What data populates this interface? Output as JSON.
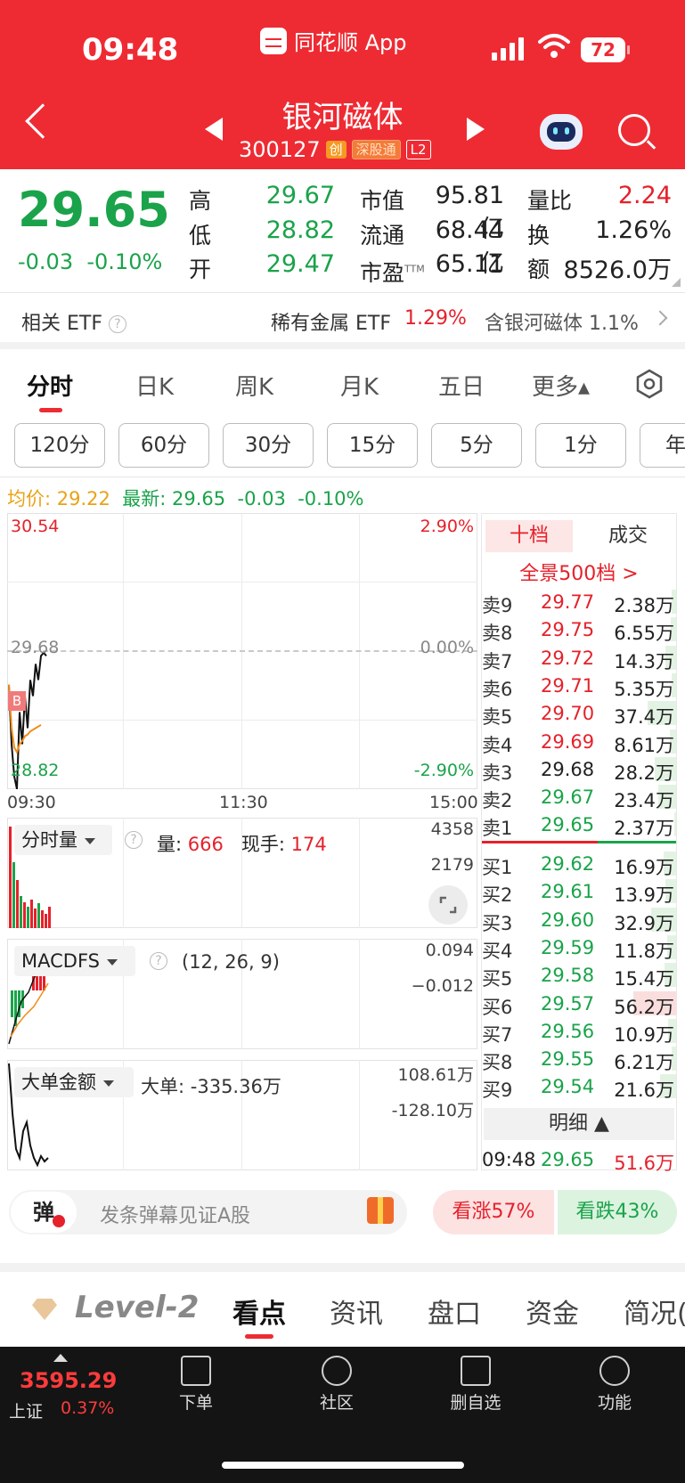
{
  "status_bar": {
    "time": "09:48",
    "app_name": "同花顺 App",
    "battery": "72"
  },
  "header": {
    "stock_name": "银河磁体",
    "stock_code": "300127",
    "tags": [
      "创",
      "深股通",
      "L2"
    ]
  },
  "quote": {
    "price": "29.65",
    "change": "-0.03",
    "change_pct": "-0.10%",
    "high_label": "高",
    "high": "29.67",
    "low_label": "低",
    "low": "28.82",
    "open_label": "开",
    "open": "29.47",
    "mktcap_label": "市值",
    "mktcap": "95.81亿",
    "float_label": "流通",
    "float": "68.44亿",
    "pe_label": "市盈",
    "pe_sup": "TTM",
    "pe": "65.11",
    "volratio_label": "量比",
    "volratio": "2.24",
    "turnover_label": "换",
    "turnover": "1.26%",
    "amount_label": "额",
    "amount": "8526.0万"
  },
  "etf": {
    "label": "相关 ETF",
    "name": "稀有金属 ETF",
    "pct": "1.29%",
    "holding": "含银河磁体 1.1%"
  },
  "tabs": [
    "分时",
    "日K",
    "周K",
    "月K",
    "五日",
    "更多▴"
  ],
  "periods": [
    "120分",
    "60分",
    "30分",
    "15分",
    "5分",
    "1分",
    "年"
  ],
  "summary": {
    "avg_label": "均价:",
    "avg": "29.22",
    "latest_label": "最新:",
    "latest": "29.65",
    "chg": "-0.03",
    "pct": "-0.10%"
  },
  "chart_data": {
    "type": "line",
    "title": "",
    "y_top": "30.54",
    "y_mid": "29.68",
    "y_bottom": "28.82",
    "pct_top": "2.90%",
    "pct_mid": "0.00%",
    "pct_bottom": "-2.90%",
    "x_ticks": [
      "09:30",
      "11:30",
      "15:00"
    ],
    "ylim": [
      28.82,
      30.54
    ],
    "series": [
      {
        "values": [
          29.47,
          29.1,
          28.9,
          28.82,
          29.3,
          29.1,
          29.4,
          29.2,
          29.5,
          29.4,
          29.6,
          29.5,
          29.65,
          29.67,
          29.65
        ]
      },
      {
        "values": [
          29.47,
          29.2,
          29.08,
          29.05,
          29.1,
          29.12,
          29.15,
          29.16,
          29.18,
          29.19,
          29.2,
          29.21,
          29.22
        ]
      }
    ],
    "buy_marker": "B"
  },
  "volume_panel": {
    "name": "分时量",
    "vol_label": "量:",
    "vol": "666",
    "hand_label": "现手:",
    "hand": "174",
    "scale_top": "4358",
    "scale_mid": "2179"
  },
  "macd_panel": {
    "name": "MACDFS",
    "params": "(12, 26, 9)",
    "scale_top": "0.094",
    "scale_mid": "−0.012"
  },
  "bigorder_panel": {
    "name": "大单金额",
    "label": "大单:",
    "value": "-335.36万",
    "scale_top": "108.61万",
    "scale_mid": "-128.10万"
  },
  "orderbook": {
    "tab_active": "十档",
    "tab_other": "成交",
    "full_link": "全景500档 >",
    "sells": [
      {
        "label": "卖9",
        "price": "29.77",
        "vol": "2.38万",
        "pc": "red",
        "fill": 0.1
      },
      {
        "label": "卖8",
        "price": "29.75",
        "vol": "6.55万",
        "pc": "red",
        "fill": 0.12
      },
      {
        "label": "卖7",
        "price": "29.72",
        "vol": "14.3万",
        "pc": "red",
        "fill": 0.25
      },
      {
        "label": "卖6",
        "price": "29.71",
        "vol": "5.35万",
        "pc": "red",
        "fill": 0.1
      },
      {
        "label": "卖5",
        "price": "29.70",
        "vol": "37.4万",
        "pc": "red",
        "fill": 0.67
      },
      {
        "label": "卖4",
        "price": "29.69",
        "vol": "8.61万",
        "pc": "red",
        "fill": 0.15
      },
      {
        "label": "卖3",
        "price": "29.68",
        "vol": "28.2万",
        "pc": "dark",
        "fill": 0.5
      },
      {
        "label": "卖2",
        "price": "29.67",
        "vol": "23.4万",
        "pc": "green",
        "fill": 0.42
      },
      {
        "label": "卖1",
        "price": "29.65",
        "vol": "2.37万",
        "pc": "green",
        "fill": 0.04
      }
    ],
    "buys": [
      {
        "label": "买1",
        "price": "29.62",
        "vol": "16.9万",
        "pc": "green",
        "fill": 0.3
      },
      {
        "label": "买2",
        "price": "29.61",
        "vol": "13.9万",
        "pc": "green",
        "fill": 0.25
      },
      {
        "label": "买3",
        "price": "29.60",
        "vol": "32.9万",
        "pc": "green",
        "fill": 0.58
      },
      {
        "label": "买4",
        "price": "29.59",
        "vol": "11.8万",
        "pc": "green",
        "fill": 0.21
      },
      {
        "label": "买5",
        "price": "29.58",
        "vol": "15.4万",
        "pc": "green",
        "fill": 0.27
      },
      {
        "label": "买6",
        "price": "29.57",
        "vol": "56.2万",
        "pc": "green",
        "fill": 1.0
      },
      {
        "label": "买7",
        "price": "29.56",
        "vol": "10.9万",
        "pc": "green",
        "fill": 0.19
      },
      {
        "label": "买8",
        "price": "29.55",
        "vol": "6.21万",
        "pc": "green",
        "fill": 0.11
      },
      {
        "label": "买9",
        "price": "29.54",
        "vol": "21.6万",
        "pc": "green",
        "fill": 0.38
      }
    ],
    "detail_label": "明细 ▲",
    "last_trade": {
      "time": "09:48",
      "price": "29.65",
      "vol": "51.6万"
    }
  },
  "danmu": {
    "icon_text": "弹",
    "placeholder": "发条弹幕见证A股",
    "up": "看涨57%",
    "down": "看跌43%"
  },
  "bottom_tabs": {
    "level2": "Level-2",
    "items": [
      "看点",
      "资讯",
      "盘口",
      "资金",
      "简况("
    ]
  },
  "index": {
    "value": "3595.29",
    "name": "上证",
    "pct": "0.37%"
  },
  "nav": [
    "下单",
    "社区",
    "删自选",
    "功能"
  ],
  "colors": {
    "brand_red": "#ee2b33",
    "up_red": "#e5212b",
    "down_green": "#1aa34a",
    "avg_yellow": "#e8a317"
  }
}
